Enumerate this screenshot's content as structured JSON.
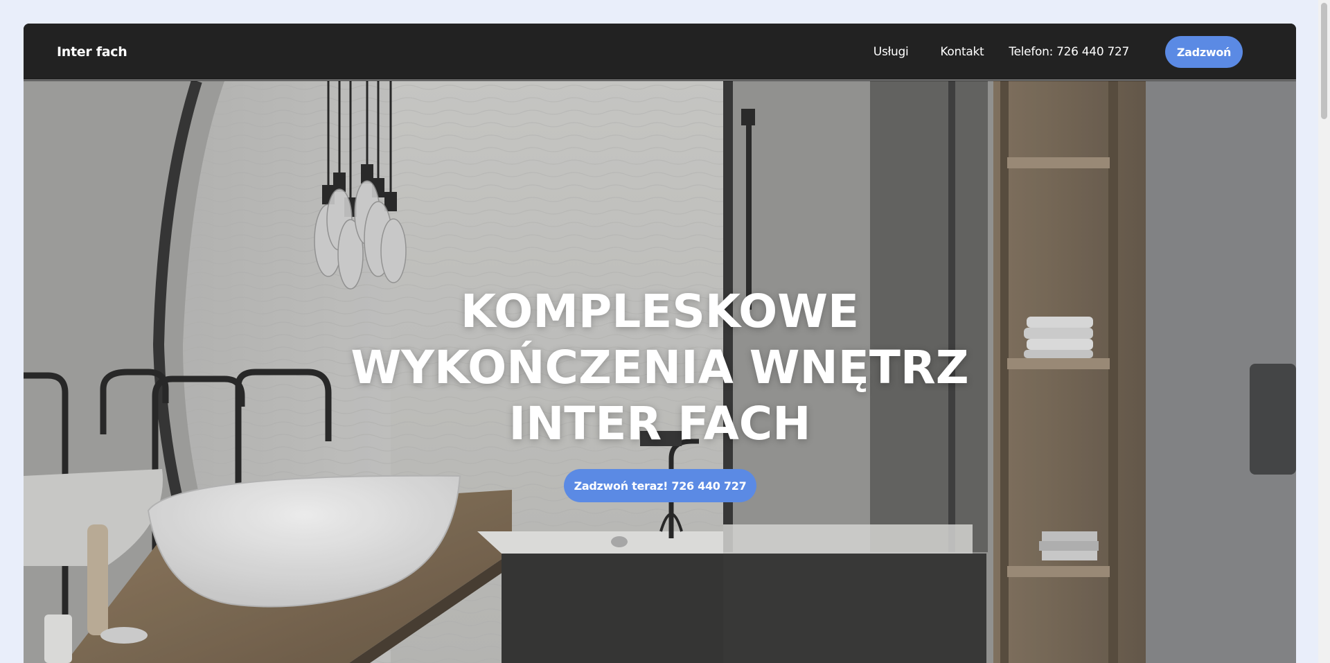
{
  "navbar": {
    "brand": "Inter fach",
    "links": [
      {
        "label": "Usługi"
      },
      {
        "label": "Kontakt"
      },
      {
        "label": "Telefon: 726 440 727"
      }
    ],
    "call_button": "Zadzwoń"
  },
  "hero": {
    "title_lines": [
      "KOMPLESKOWE",
      "WYKOŃCZENIA WNĘTRZ",
      "INTER FACH"
    ],
    "cta": "Zadzwoń teraz! 726 440 727",
    "image": "bathroom-interior-photo"
  },
  "colors": {
    "accent": "#5b8ae4",
    "navbar_bg": "#222222",
    "page_bg": "#e9eefa"
  }
}
